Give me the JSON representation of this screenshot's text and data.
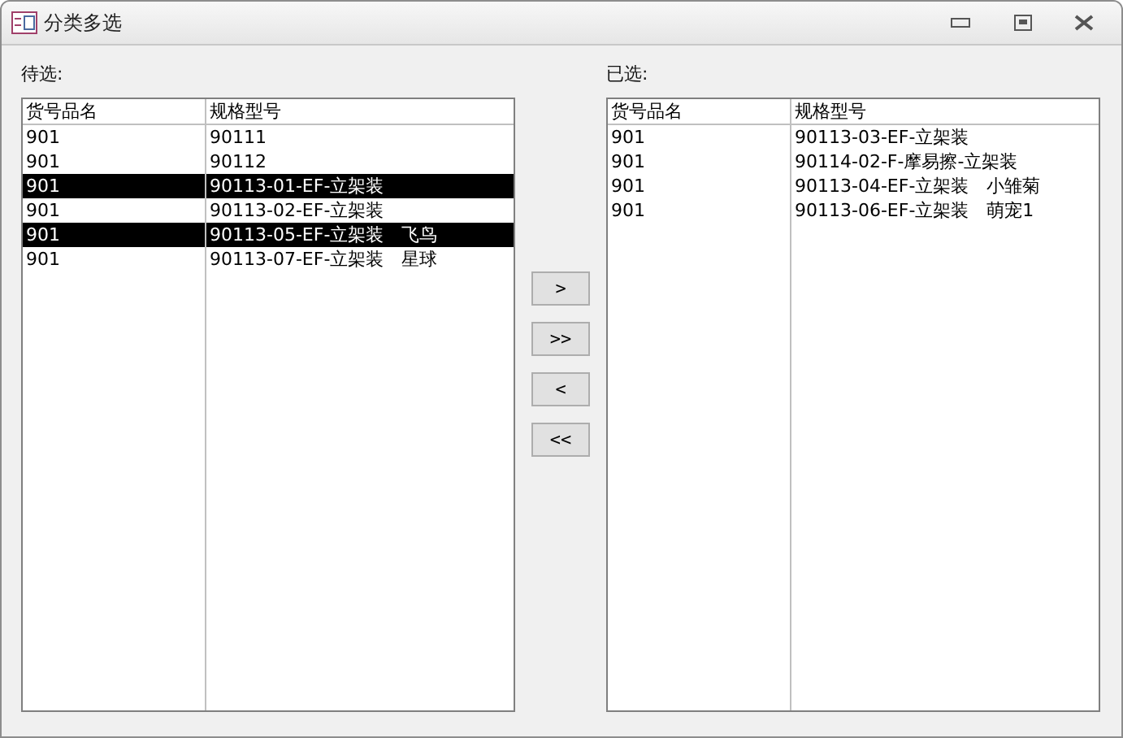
{
  "window": {
    "title": "分类多选"
  },
  "available": {
    "label": "待选:",
    "columns": [
      "货号品名",
      "规格型号"
    ],
    "rows": [
      {
        "cells": [
          "901",
          "90111"
        ],
        "selected": false
      },
      {
        "cells": [
          "901",
          "90112"
        ],
        "selected": false
      },
      {
        "cells": [
          "901",
          "90113-01-EF-立架装"
        ],
        "selected": true
      },
      {
        "cells": [
          "901",
          "90113-02-EF-立架装"
        ],
        "selected": false
      },
      {
        "cells": [
          "901",
          "90113-05-EF-立架装　飞鸟"
        ],
        "selected": true
      },
      {
        "cells": [
          "901",
          "90113-07-EF-立架装　星球"
        ],
        "selected": false
      }
    ]
  },
  "buttons": [
    ">",
    ">>",
    "<",
    "<<"
  ],
  "chosen": {
    "label": "已选:",
    "columns": [
      "货号品名",
      "规格型号"
    ],
    "rows": [
      {
        "cells": [
          "901",
          "90113-03-EF-立架装"
        ],
        "selected": false
      },
      {
        "cells": [
          "901",
          "90114-02-F-摩易擦-立架装"
        ],
        "selected": false
      },
      {
        "cells": [
          "901",
          "90113-04-EF-立架装　小雏菊"
        ],
        "selected": false
      },
      {
        "cells": [
          "901",
          "90113-06-EF-立架装　萌宠1"
        ],
        "selected": false
      }
    ]
  }
}
